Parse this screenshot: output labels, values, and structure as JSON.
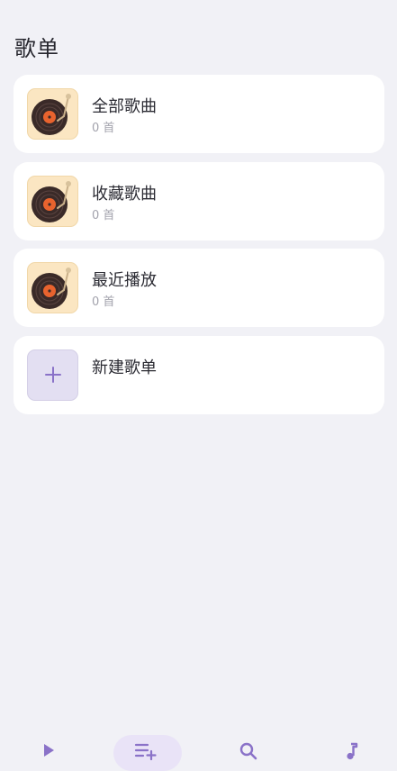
{
  "page": {
    "title": "歌单"
  },
  "playlists": [
    {
      "title": "全部歌曲",
      "count": "0 首",
      "icon": "record-player-icon"
    },
    {
      "title": "收藏歌曲",
      "count": "0 首",
      "icon": "record-player-icon"
    },
    {
      "title": "最近播放",
      "count": "0 首",
      "icon": "record-player-icon"
    }
  ],
  "new_playlist": {
    "title": "新建歌单",
    "icon": "plus-icon"
  },
  "tabbar": {
    "tabs": [
      {
        "icon": "play-icon",
        "active": false
      },
      {
        "icon": "playlist-add-icon",
        "active": true
      },
      {
        "icon": "search-icon",
        "active": false
      },
      {
        "icon": "music-note-icon",
        "active": false
      }
    ]
  },
  "colors": {
    "background": "#f1f1f6",
    "card": "#ffffff",
    "accent": "#8a72c8",
    "accent_light": "#e9e3f7",
    "thumb_bg": "#fbe6c2"
  }
}
